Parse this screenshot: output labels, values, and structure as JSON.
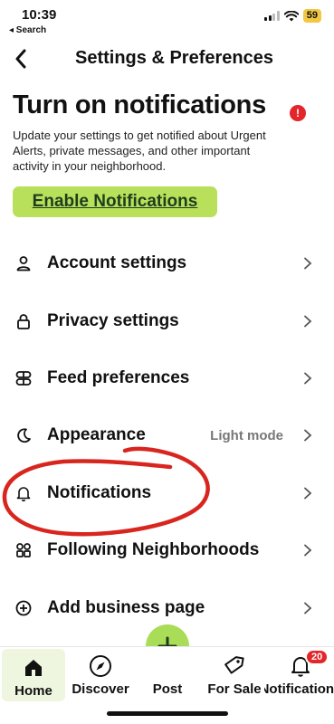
{
  "status_bar": {
    "time": "10:39",
    "back_app": "◂ Search",
    "battery": "59"
  },
  "header": {
    "title": "Settings & Preferences",
    "back_icon": "chevron-left-icon"
  },
  "promo": {
    "title": "Turn on notifications",
    "alert_glyph": "!",
    "body": "Update your settings to get notified about Urgent Alerts, private messages, and other important activity in your neighborhood.",
    "button_label": "Enable Notifications",
    "button_color": "#b8e05a",
    "alert_color": "#e4252a"
  },
  "settings": [
    {
      "label": "Account settings",
      "icon": "person-icon",
      "value": ""
    },
    {
      "label": "Privacy settings",
      "icon": "lock-icon",
      "value": ""
    },
    {
      "label": "Feed preferences",
      "icon": "feed-icon",
      "value": ""
    },
    {
      "label": "Appearance",
      "icon": "moon-icon",
      "value": "Light mode"
    },
    {
      "label": "Notifications",
      "icon": "bell-icon",
      "value": ""
    },
    {
      "label": "Following Neighborhoods",
      "icon": "grid-icon",
      "value": ""
    },
    {
      "label": "Add business page",
      "icon": "plus-circle-icon",
      "value": ""
    }
  ],
  "annotation_color": "#d8261f",
  "tabbar": {
    "home": "Home",
    "discover": "Discover",
    "post": "Post",
    "for_sale": "For Sale",
    "notifications": "Notifications",
    "notifications_badge": "20",
    "accent": "#a9dc57"
  }
}
